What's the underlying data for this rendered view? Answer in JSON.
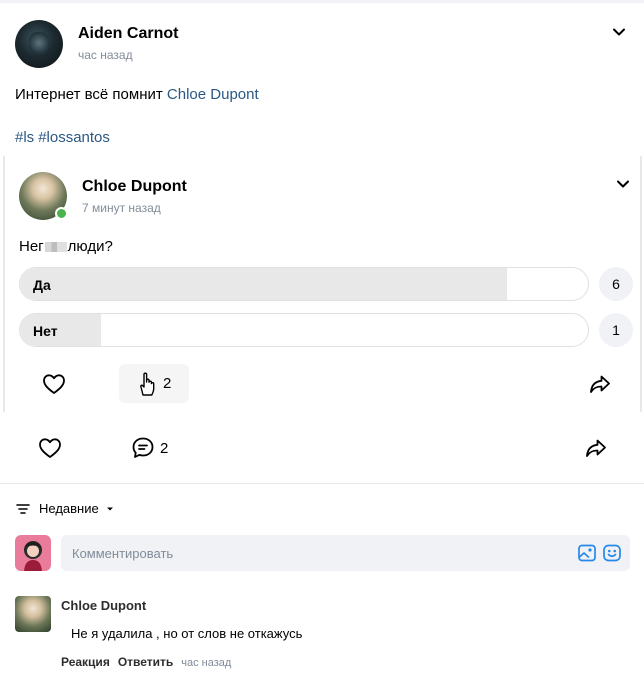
{
  "post": {
    "author": "Aiden Carnot",
    "time": "час назад",
    "text_prefix": "Интернет всё помнит ",
    "text_link": "Chloe Dupont",
    "hashtags": [
      "#ls",
      "#lossantos"
    ],
    "actions": {
      "comments_count": "2"
    }
  },
  "repost": {
    "author": "Chloe Dupont",
    "time": "7 минут назад",
    "question_start": "Нег",
    "question_end": "люди?",
    "poll": [
      {
        "label": "Да",
        "votes": "6",
        "fraction": 0.857
      },
      {
        "label": "Нет",
        "votes": "1",
        "fraction": 0.143
      }
    ],
    "actions": {
      "comments_count": "2"
    }
  },
  "sort": {
    "label": "Недавние"
  },
  "comment_input": {
    "placeholder": "Комментировать"
  },
  "comments": [
    {
      "author": "Chloe Dupont",
      "text": "Не я удалила , но от слов не откажусь",
      "reaction_label": "Реакция",
      "reply_label": "Ответить",
      "time": "час назад"
    }
  ],
  "icons": {
    "chevron": "chevron-down-icon",
    "like": "heart-icon",
    "comment": "comment-icon",
    "share": "share-icon",
    "sort": "sort-lines-icon",
    "image": "image-icon",
    "emoji": "emoji-icon"
  },
  "colors": {
    "link": "#2a5885",
    "online": "#4bb34b",
    "muted": "#818c99",
    "poll_fill": "#e8e8e8"
  }
}
